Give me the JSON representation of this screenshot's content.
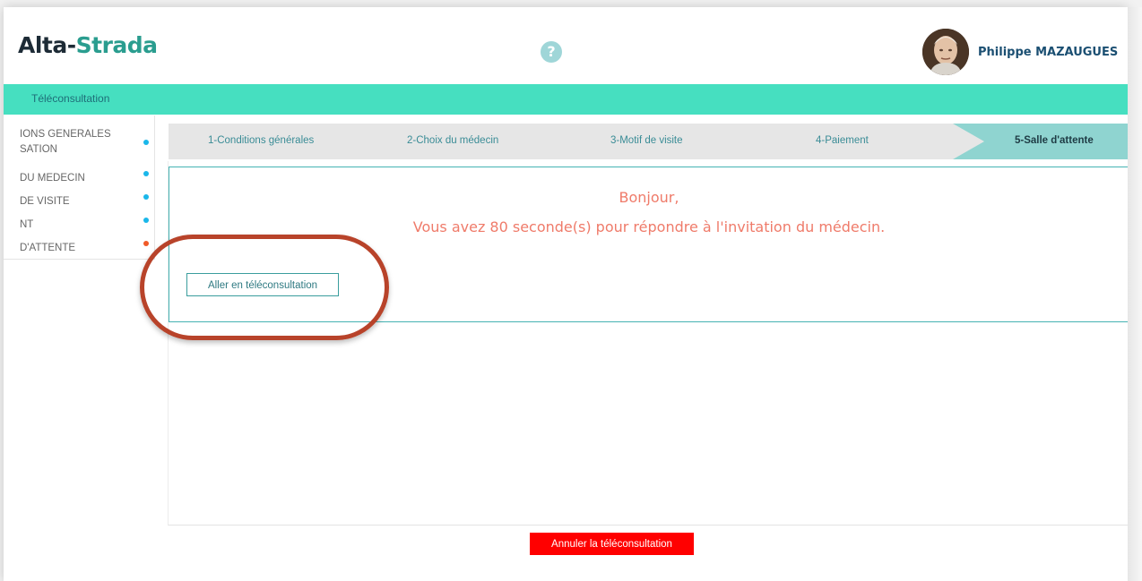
{
  "header": {
    "logo_part1": "Alta-",
    "logo_part2": "Strada",
    "help_icon": "question-circle-icon",
    "user_name": "Philippe MAZAUGUES"
  },
  "top_bar": {
    "label": "Téléconsultation"
  },
  "sidebar": {
    "items": [
      {
        "label_line1": "IONS GENERALES",
        "label_line2": "SATION",
        "dot_color": "#1ab7ea"
      },
      {
        "label_line1": "DU MEDECIN",
        "dot_color": "#1ab7ea"
      },
      {
        "label_line1": "DE VISITE",
        "dot_color": "#1ab7ea"
      },
      {
        "label_line1": "NT",
        "dot_color": "#1ab7ea"
      },
      {
        "label_line1": "D'ATTENTE",
        "dot_color": "#f05a28"
      }
    ]
  },
  "stepper": {
    "steps": [
      {
        "label": "1-Conditions générales"
      },
      {
        "label": "2-Choix du médecin"
      },
      {
        "label": "3-Motif de visite"
      },
      {
        "label": "4-Paiement"
      },
      {
        "label": "5-Salle d'attente",
        "active": true
      }
    ]
  },
  "message": {
    "greeting": "Bonjour,",
    "invitation": "Vous avez 80 seconde(s) pour répondre à l'invitation du médecin."
  },
  "buttons": {
    "go_label": "Aller en téléconsultation",
    "cancel_label": "Annuler la téléconsultation"
  },
  "colors": {
    "accent_teal": "#46dfc0",
    "message_text": "#ef7b6a",
    "cancel_red": "#ff0000",
    "highlight_ring": "#b8432a"
  }
}
